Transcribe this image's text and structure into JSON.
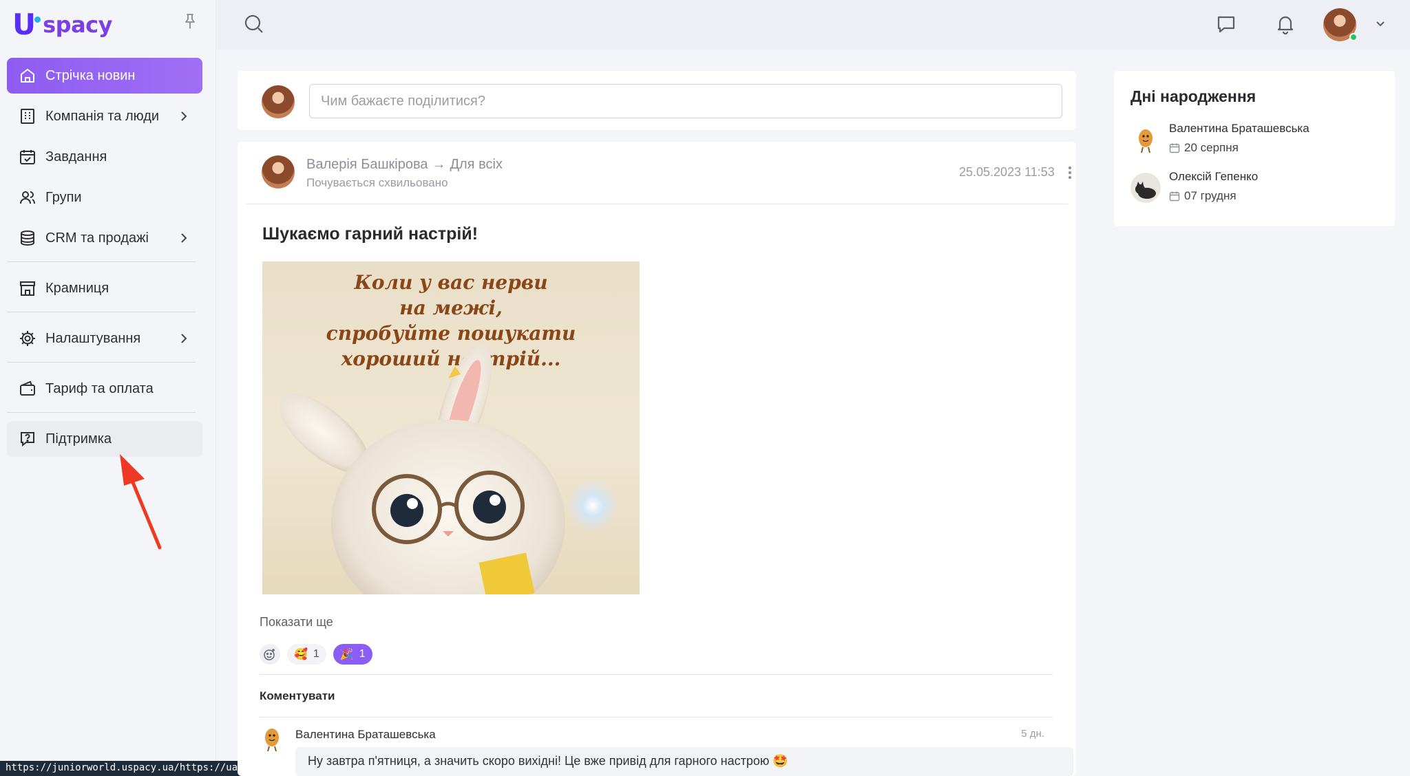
{
  "brand": {
    "logo_u": "U",
    "logo_text": "spacy"
  },
  "sidebar": {
    "items": [
      {
        "label": "Стрічка новин"
      },
      {
        "label": "Компанія та люди"
      },
      {
        "label": "Завдання"
      },
      {
        "label": "Групи"
      },
      {
        "label": "CRM та продажі"
      },
      {
        "label": "Крамниця"
      },
      {
        "label": "Налаштування"
      },
      {
        "label": "Тариф та оплата"
      },
      {
        "label": "Підтримка"
      }
    ]
  },
  "composer": {
    "placeholder": "Чим бажаєте поділитися?"
  },
  "post": {
    "author": "Валерія Башкірова",
    "arrow": "→",
    "audience": "Для всіх",
    "mood": "Почувається схвильовано",
    "date": "25.05.2023 11:53",
    "title": "Шукаємо гарний настрій!",
    "image_caption": [
      "Коли у вас нерви",
      "на межі,",
      "спробуйте пошукати",
      "хороший настрій..."
    ],
    "show_more": "Показати ще",
    "reactions": [
      {
        "emoji": "🥰",
        "count": "1"
      },
      {
        "emoji": "🎉",
        "count": "1"
      }
    ],
    "comment_label": "Коментувати",
    "comment": {
      "author": "Валентина Браташевська",
      "age": "5 дн.",
      "text": "Ну завтра п'ятниця, а значить скоро вихідні! Це вже привід для гарного настрою 🤩"
    }
  },
  "birthdays": {
    "title": "Дні народження",
    "items": [
      {
        "name": "Валентина Браташевська",
        "date": "20 серпня"
      },
      {
        "name": "Олексій Гепенко",
        "date": "07 грудня"
      }
    ]
  },
  "status_bar": {
    "url": "https://juniorworld.uspacy.ua/https://ua.uspacy.support/"
  },
  "colors": {
    "accent": "#8b5cf6",
    "online": "#22c55e",
    "brand": "#5b2ef5"
  }
}
